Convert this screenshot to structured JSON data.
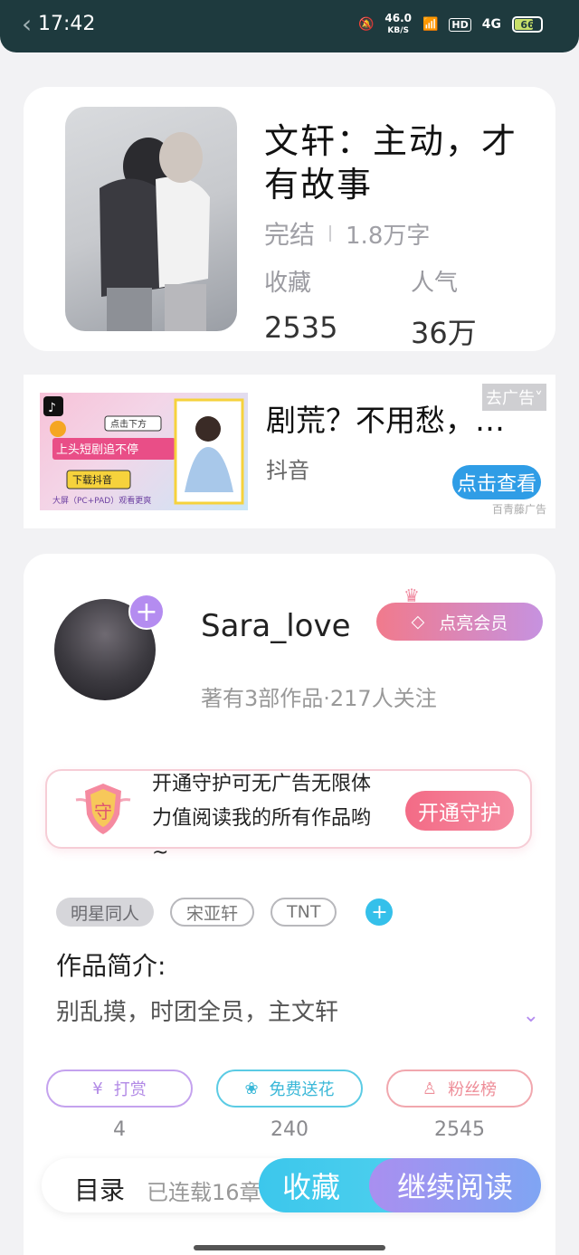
{
  "status_bar": {
    "time": "17:42",
    "net_speed": "46.0",
    "net_unit": "KB/S",
    "hd": "HD",
    "signal": "4G",
    "battery": "66"
  },
  "book": {
    "title": "文轩：主动，才有故事",
    "status": "完结",
    "word_count": "1.8万字",
    "collect_label": "收藏",
    "collect_value": "2535",
    "popularity_label": "人气",
    "popularity_value": "36万"
  },
  "ad": {
    "title": "剧荒？不用愁，…",
    "source": "抖音",
    "close_label": "去广告",
    "cta": "点击查看",
    "brand": "百青藤广告",
    "image_lines": [
      "点击下方",
      "上头短剧追不停",
      "下载抖音",
      "大屏（PC+PAD）观看更爽"
    ]
  },
  "author": {
    "name": "Sara_love",
    "vip_button": "点亮会员",
    "meta": "著有3部作品·217人关注",
    "guard_text": "开通守护可无广告无限体力值阅读我的所有作品哟~",
    "guard_badge": "守",
    "guard_button": "开通守护"
  },
  "tags": [
    "明星同人",
    "宋亚轩",
    "TNT"
  ],
  "intro": {
    "heading": "作品简介:",
    "text": "别乱摸，时团全员，主文轩"
  },
  "actions": [
    {
      "label": "打赏",
      "value": "4"
    },
    {
      "label": "免费送花",
      "value": "240"
    },
    {
      "label": "粉丝榜",
      "value": "2545"
    }
  ],
  "bottom_bar": {
    "directory": "目录",
    "progress": "已连载16章",
    "favorite": "收藏",
    "continue": "继续阅读"
  }
}
